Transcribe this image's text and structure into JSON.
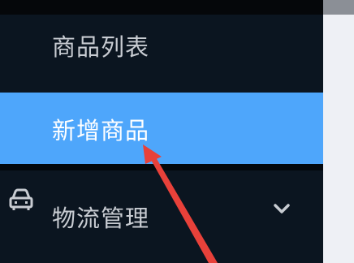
{
  "sidebar": {
    "items": [
      {
        "label": "商品列表",
        "icon": null,
        "selected": false
      },
      {
        "label": "新增商品",
        "icon": null,
        "selected": true
      },
      {
        "label": "物流管理",
        "icon": "car-icon",
        "selected": false,
        "expandable": true
      }
    ]
  },
  "colors": {
    "sidebar_bg": "#0b1520",
    "selected_bg": "#4ea6fb",
    "text": "#c8ccd2",
    "selected_text": "#ffffff",
    "content_bg": "#eef0f5",
    "annotation_arrow": "#e8413a"
  },
  "annotation": {
    "icon": "red-arrow-pointer"
  }
}
